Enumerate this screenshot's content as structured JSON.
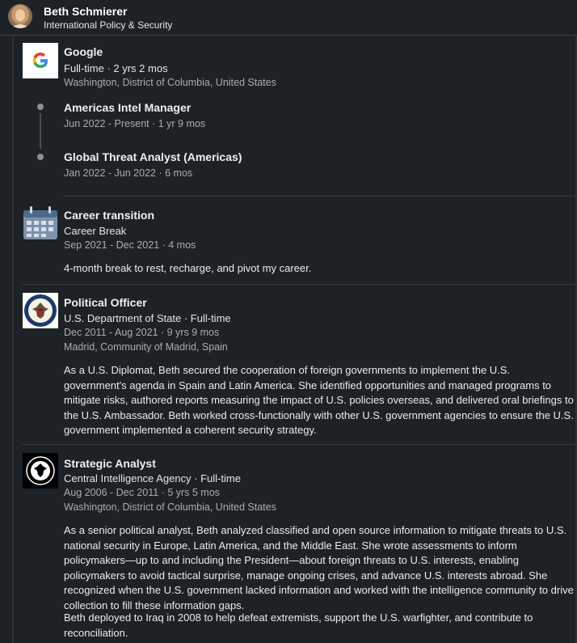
{
  "profile": {
    "name": "Beth Schmierer",
    "headline": "International Policy & Security"
  },
  "experience": {
    "google": {
      "company": "Google",
      "employment": "Full-time · 2 yrs 2 mos",
      "location": "Washington, District of Columbia, United States",
      "roles": [
        {
          "title": "Americas Intel Manager",
          "dates": "Jun 2022 - Present · 1 yr 9 mos"
        },
        {
          "title": "Global Threat Analyst (Americas)",
          "dates": "Jan 2022 - Jun 2022 · 6 mos"
        }
      ]
    },
    "career_break": {
      "title": "Career transition",
      "type": "Career Break",
      "dates": "Sep 2021 - Dec 2021 · 4 mos",
      "description": "4-month break to rest, recharge, and pivot my career."
    },
    "state_dept": {
      "title": "Political Officer",
      "org": "U.S. Department of State · Full-time",
      "dates": "Dec 2011 - Aug 2021 · 9 yrs 9 mos",
      "location": "Madrid, Community of Madrid, Spain",
      "description": "As a U.S. Diplomat, Beth secured the cooperation of foreign governments to implement the U.S. government's agenda in Spain and Latin America. She identified opportunities and managed programs to mitigate risks, authored reports measuring the impact of U.S. policies overseas, and delivered oral briefings to the U.S. Ambassador. Beth worked cross-functionally with other U.S. government agencies to ensure the U.S. government implemented a coherent security strategy."
    },
    "cia": {
      "title": "Strategic Analyst",
      "org": "Central Intelligence Agency · Full-time",
      "dates": "Aug 2006 - Dec 2011 · 5 yrs 5 mos",
      "location": "Washington, District of Columbia, United States",
      "description": "As a senior political analyst, Beth analyzed classified and open source information to mitigate threats to U.S. national security in Europe, Latin America, and the Middle East. She wrote assessments to inform policymakers—up to and including the President—about foreign threats to U.S. interests, enabling policymakers to avoid tactical surprise, manage ongoing crises, and advance U.S. interests abroad. She recognized when the U.S. government lacked information and worked with the intelligence community to drive collection to fill these information gaps.",
      "description2": "Beth deployed to Iraq in 2008 to help defeat extremists, support the U.S. warfighter, and contribute to reconciliation."
    }
  }
}
